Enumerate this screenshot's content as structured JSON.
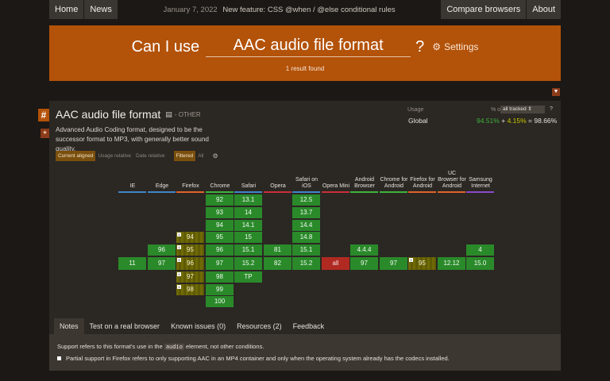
{
  "nav": {
    "home": "Home",
    "news": "News",
    "date": "January 7, 2022",
    "headline": "New feature: CSS @when / @else conditional rules",
    "compare": "Compare browsers",
    "about": "About"
  },
  "search": {
    "prefix": "Can I use",
    "value": "AAC audio file format",
    "question_mark": "?",
    "settings": "Settings",
    "result_count": "1 result found"
  },
  "feature": {
    "title": "AAC audio file format",
    "category": "- OTHER",
    "description": "Advanced Audio Coding format, designed to be the successor format to MP3, with generally better sound quality.",
    "usage_label": "Usage",
    "usage_of": "% of",
    "tracked_option": "all tracked",
    "help": "?",
    "global_label": "Global",
    "global_full": "94.51%",
    "plus": "+",
    "global_partial": "4.15%",
    "equals": "=",
    "global_total": "98.66%",
    "view": {
      "current_aligned": "Current aligned",
      "usage_relative": "Usage relative",
      "date_relative": "Date relative",
      "filtered": "Filtered",
      "all": "All"
    }
  },
  "browsers": [
    {
      "name": "IE",
      "color": "#3f86c8",
      "rows": [
        null,
        null,
        null,
        null,
        null,
        {
          "v": "11",
          "s": "y"
        },
        null,
        null,
        null
      ]
    },
    {
      "name": "Edge",
      "color": "#3f86c8",
      "rows": [
        null,
        null,
        null,
        null,
        {
          "v": "96",
          "s": "y"
        },
        {
          "v": "97",
          "s": "y"
        },
        null,
        null,
        null
      ]
    },
    {
      "name": "Firefox",
      "color": "#e0622a",
      "rows": [
        null,
        null,
        null,
        {
          "v": "94",
          "s": "p",
          "n": "1"
        },
        {
          "v": "95",
          "s": "p",
          "n": "1"
        },
        {
          "v": "96",
          "s": "p",
          "n": "1"
        },
        {
          "v": "97",
          "s": "p",
          "n": "1"
        },
        {
          "v": "98",
          "s": "p",
          "n": "1"
        },
        null
      ]
    },
    {
      "name": "Chrome",
      "color": "#3cb43c",
      "rows": [
        {
          "v": "92",
          "s": "y"
        },
        {
          "v": "93",
          "s": "y"
        },
        {
          "v": "94",
          "s": "y"
        },
        {
          "v": "95",
          "s": "y"
        },
        {
          "v": "96",
          "s": "y"
        },
        {
          "v": "97",
          "s": "y"
        },
        {
          "v": "98",
          "s": "y"
        },
        {
          "v": "99",
          "s": "y"
        },
        {
          "v": "100",
          "s": "y"
        }
      ]
    },
    {
      "name": "Safari",
      "color": "#3f86c8",
      "rows": [
        {
          "v": "13.1",
          "s": "y"
        },
        {
          "v": "14",
          "s": "y"
        },
        {
          "v": "14.1",
          "s": "y"
        },
        {
          "v": "15",
          "s": "y"
        },
        {
          "v": "15.1",
          "s": "y"
        },
        {
          "v": "15.2",
          "s": "y"
        },
        {
          "v": "TP",
          "s": "y"
        },
        null,
        null
      ]
    },
    {
      "name": "Opera",
      "color": "#c8303a",
      "rows": [
        null,
        null,
        null,
        null,
        {
          "v": "81",
          "s": "y"
        },
        {
          "v": "82",
          "s": "y"
        },
        null,
        null,
        null
      ]
    },
    {
      "name": "Safari on iOS",
      "color": "#3f86c8",
      "rows": [
        {
          "v": "12.5",
          "s": "y"
        },
        {
          "v": "13.7",
          "s": "y"
        },
        {
          "v": "14.4",
          "s": "y"
        },
        {
          "v": "14.8",
          "s": "y"
        },
        {
          "v": "15.1",
          "s": "y"
        },
        {
          "v": "15.2",
          "s": "y"
        },
        null,
        null,
        null
      ]
    },
    {
      "name": "Opera Mini",
      "color": "#c8303a",
      "rows": [
        null,
        null,
        null,
        null,
        null,
        {
          "v": "all",
          "s": "n"
        },
        null,
        null,
        null
      ]
    },
    {
      "name": "Android Browser",
      "color": "#3cb43c",
      "rows": [
        null,
        null,
        null,
        null,
        {
          "v": "4.4.4",
          "s": "y"
        },
        {
          "v": "97",
          "s": "y"
        },
        null,
        null,
        null
      ]
    },
    {
      "name": "Chrome for Android",
      "color": "#3cb43c",
      "rows": [
        null,
        null,
        null,
        null,
        null,
        {
          "v": "97",
          "s": "y"
        },
        null,
        null,
        null
      ]
    },
    {
      "name": "Firefox for Android",
      "color": "#e0622a",
      "rows": [
        null,
        null,
        null,
        null,
        null,
        {
          "v": "95",
          "s": "p",
          "n": "1"
        },
        null,
        null,
        null
      ]
    },
    {
      "name": "UC Browser for Android",
      "color": "#e0622a",
      "rows": [
        null,
        null,
        null,
        null,
        null,
        {
          "v": "12.12",
          "s": "y"
        },
        null,
        null,
        null
      ]
    },
    {
      "name": "Samsung Internet",
      "color": "#8a4ac8",
      "rows": [
        null,
        null,
        null,
        null,
        {
          "v": "4",
          "s": "y"
        },
        {
          "v": "15.0",
          "s": "y"
        },
        null,
        null,
        null
      ]
    }
  ],
  "tabs": {
    "notes": "Notes",
    "test": "Test on a real browser",
    "issues": "Known issues (0)",
    "resources": "Resources (2)",
    "feedback": "Feedback"
  },
  "notes": {
    "line1_pre": "Support refers to this format's use in the",
    "line1_code": "audio",
    "line1_post": "element, not other conditions.",
    "note_1": "Partial support in Firefox refers to only supporting AAC in an MP4 container and only when the operating system already has the codecs installed."
  }
}
